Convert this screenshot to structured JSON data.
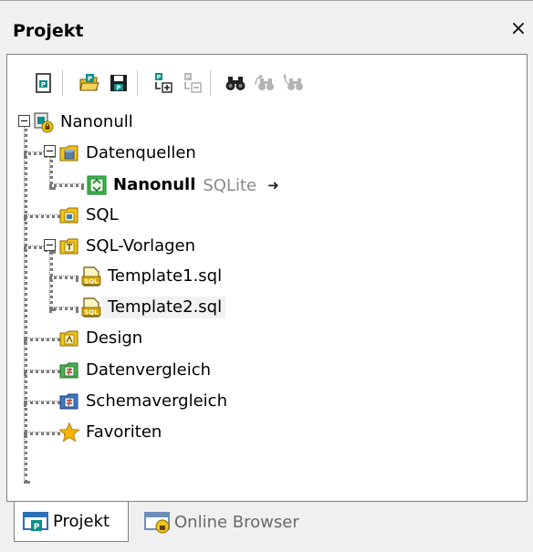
{
  "panel": {
    "title": "Projekt",
    "close_glyph": "×"
  },
  "toolbar": {
    "buttons": [
      {
        "name": "new-project-icon",
        "enabled": true
      },
      {
        "name": "open-project-icon",
        "enabled": true
      },
      {
        "name": "save-project-icon",
        "enabled": true
      },
      {
        "name": "add-to-project-icon",
        "enabled": true
      },
      {
        "name": "remove-from-project-icon",
        "enabled": false
      },
      {
        "name": "find-icon",
        "enabled": true
      },
      {
        "name": "find-next-icon",
        "enabled": false
      },
      {
        "name": "find-previous-icon",
        "enabled": false
      }
    ]
  },
  "tree": {
    "root": {
      "label": "Nanonull",
      "icon": "project-root-icon"
    },
    "datenquellen": {
      "label": "Datenquellen",
      "icon": "folder-datasources-icon"
    },
    "datasource": {
      "label": "Nanonull",
      "sublabel": "SQLite",
      "arrow": "➜",
      "icon": "datasource-connection-icon"
    },
    "sql": {
      "label": "SQL",
      "icon": "folder-sql-icon"
    },
    "sql_vorlagen": {
      "label": "SQL-Vorlagen",
      "icon": "folder-templates-icon"
    },
    "template1": {
      "label": "Template1.sql",
      "icon": "sql-file-icon"
    },
    "template2": {
      "label": "Template2.sql",
      "icon": "sql-file-icon"
    },
    "design": {
      "label": "Design",
      "icon": "folder-design-icon"
    },
    "datenvergleich": {
      "label": "Datenvergleich",
      "icon": "folder-data-compare-icon"
    },
    "schemavergleich": {
      "label": "Schemavergleich",
      "icon": "folder-schema-compare-icon"
    },
    "favoriten": {
      "label": "Favoriten",
      "icon": "star-icon"
    }
  },
  "tabs": [
    {
      "label": "Projekt",
      "active": true,
      "icon": "project-tab-icon"
    },
    {
      "label": "Online Browser",
      "active": false,
      "icon": "online-browser-tab-icon"
    }
  ],
  "colors": {
    "folder_yellow": "#f0c419",
    "green_accent": "#2f9e44",
    "blue_accent": "#1e6fb5",
    "star": "#f7b500"
  }
}
